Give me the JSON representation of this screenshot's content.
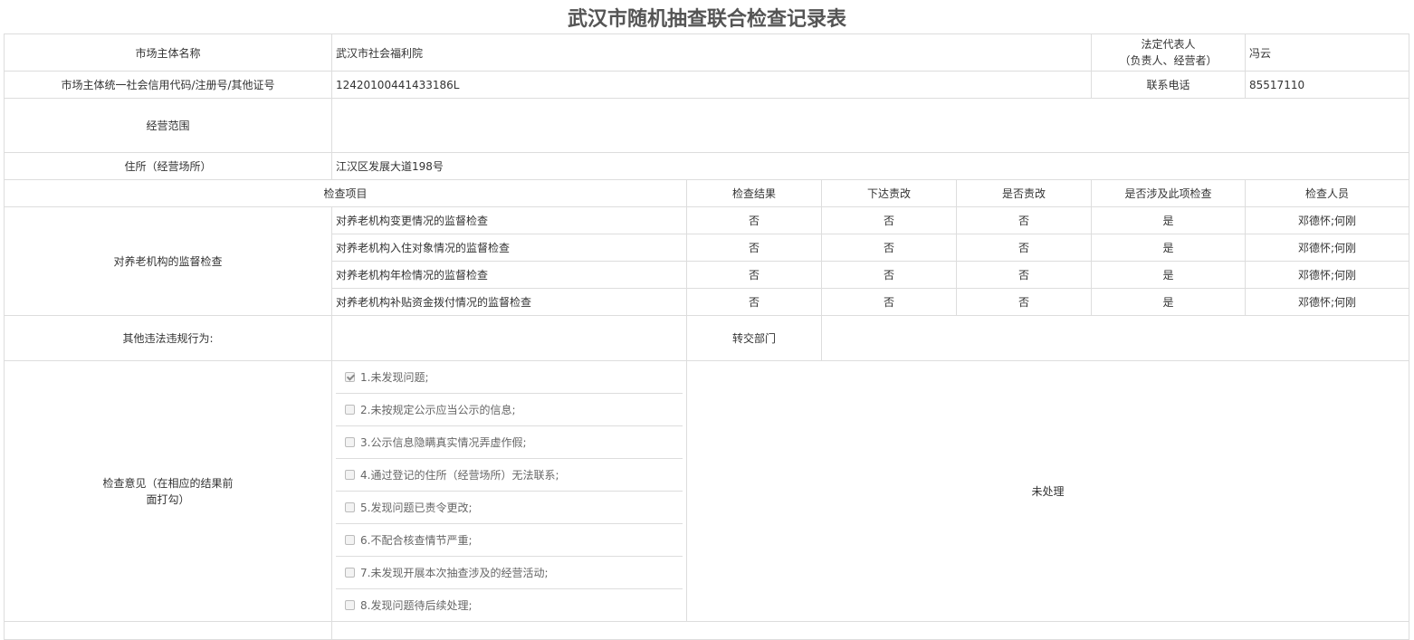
{
  "title": "武汉市随机抽查联合检查记录表",
  "subject": {
    "name_label": "市场主体名称",
    "name_value": "武汉市社会福利院",
    "legal_rep_label_line1": "法定代表人",
    "legal_rep_label_line2": "（负责人、经营者）",
    "legal_rep_value": "冯云",
    "credit_code_label": "市场主体统一社会信用代码/注册号/其他证号",
    "credit_code_value": "12420100441433186L",
    "phone_label": "联系电话",
    "phone_value": "85517110",
    "scope_label": "经营范围",
    "scope_value": "",
    "address_label": "住所（经营场所）",
    "address_value": "江汉区发展大道198号"
  },
  "inspection": {
    "headers": {
      "item": "检查项目",
      "result": "检查结果",
      "order": "下达责改",
      "corrected": "是否责改",
      "involved": "是否涉及此项检查",
      "inspectors": "检查人员"
    },
    "group_label": "对养老机构的监督检查",
    "rows": [
      {
        "item": "对养老机构变更情况的监督检查",
        "result": "否",
        "order": "否",
        "corrected": "否",
        "involved": "是",
        "inspectors": "邓德怀;何刚"
      },
      {
        "item": "对养老机构入住对象情况的监督检查",
        "result": "否",
        "order": "否",
        "corrected": "否",
        "involved": "是",
        "inspectors": "邓德怀;何刚"
      },
      {
        "item": "对养老机构年检情况的监督检查",
        "result": "否",
        "order": "否",
        "corrected": "否",
        "involved": "是",
        "inspectors": "邓德怀;何刚"
      },
      {
        "item": "对养老机构补贴资金拨付情况的监督检查",
        "result": "否",
        "order": "否",
        "corrected": "否",
        "involved": "是",
        "inspectors": "邓德怀;何刚"
      }
    ]
  },
  "other": {
    "violations_label": "其他违法违规行为:",
    "violations_value": "",
    "transfer_label": "转交部门",
    "transfer_value": ""
  },
  "opinion": {
    "label_line1": "检查意见（在相应的结果前",
    "label_line2": "面打勾）",
    "options": [
      {
        "text": "1.未发现问题;",
        "checked": true
      },
      {
        "text": "2.未按规定公示应当公示的信息;",
        "checked": false
      },
      {
        "text": "3.公示信息隐瞒真实情况弄虚作假;",
        "checked": false
      },
      {
        "text": "4.通过登记的住所（经营场所）无法联系;",
        "checked": false
      },
      {
        "text": "5.发现问题已责令更改;",
        "checked": false
      },
      {
        "text": "6.不配合核查情节严重;",
        "checked": false
      },
      {
        "text": "7.未发现开展本次抽查涉及的经营活动;",
        "checked": false
      },
      {
        "text": "8.发现问题待后续处理;",
        "checked": false
      }
    ],
    "status": "未处理"
  }
}
